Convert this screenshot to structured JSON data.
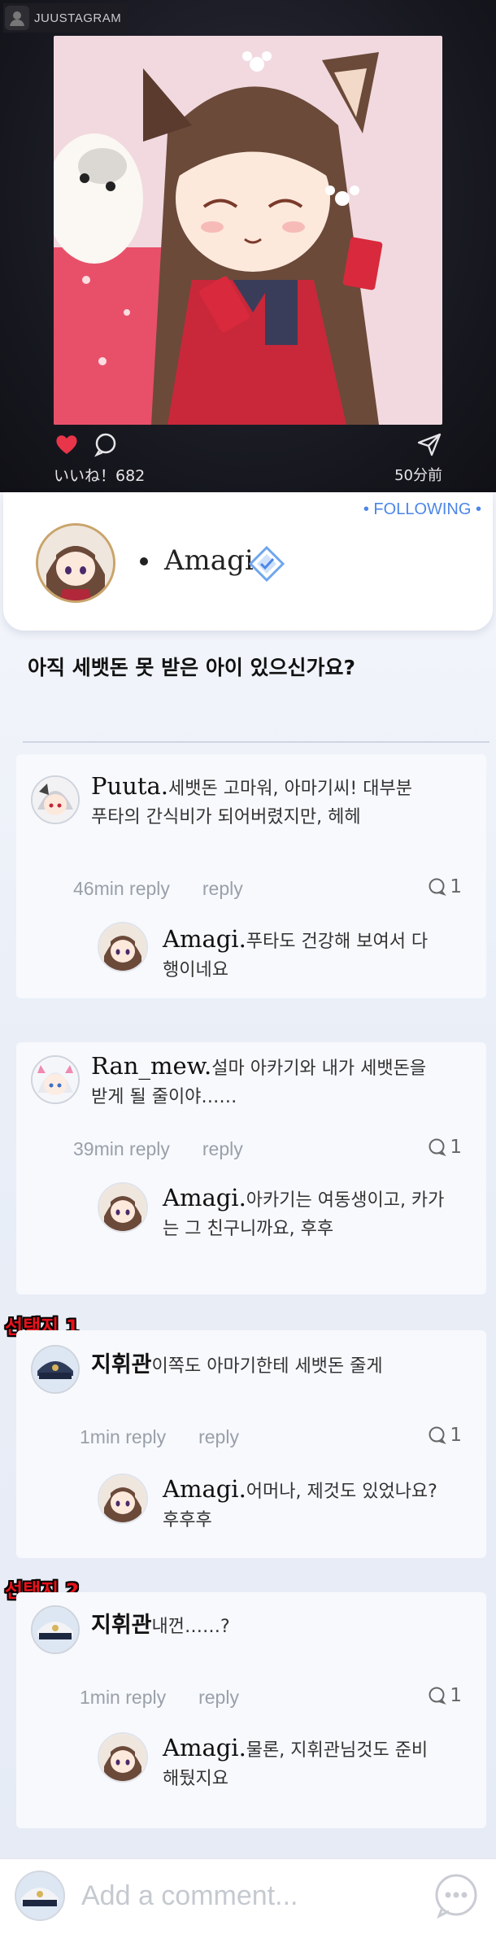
{
  "app": {
    "brand": "JUUSTAGRAM"
  },
  "post": {
    "likes": "いいね！682",
    "time": "50分前"
  },
  "profile": {
    "name": "Amagi",
    "following": "• FOLLOWING •"
  },
  "question": "아직 세뱃돈 못 받은 아이 있으신가요?",
  "comments": [
    {
      "user": "Puuta.",
      "text_line1": "세뱃돈 고마워, 아마기씨! 대부분",
      "text_line2": "푸타의 간식비가 되어버렸지만, 헤헤",
      "time": "46min reply",
      "reply_label": "reply",
      "reply_count": "1",
      "reply": {
        "user": "Amagi.",
        "text_line1": "푸타도 건강해 보여서 다",
        "text_line2": "행이네요"
      }
    },
    {
      "user": "Ran_mew.",
      "text_line1": "설마 아카기와 내가 세뱃돈을",
      "text_line2": "받게 될 줄이야……",
      "time": "39min reply",
      "reply_label": "reply",
      "reply_count": "1",
      "reply": {
        "user": "Amagi.",
        "text_line1": "아카기는 여동생이고, 카가",
        "text_line2": "는 그 친구니까요, 후후"
      }
    },
    {
      "choice": "선택지 1",
      "user": "지휘관",
      "text_line1": "이쪽도 아마기한테 세뱃돈 줄게",
      "text_line2": "",
      "time": "1min reply",
      "reply_label": "reply",
      "reply_count": "1",
      "reply": {
        "user": "Amagi.",
        "text_line1": "어머나, 제것도 있었나요?",
        "text_line2": "후후후"
      }
    },
    {
      "choice": "선택지 2",
      "user": "지휘관",
      "text_line1": "내껀……?",
      "text_line2": "",
      "time": "1min reply",
      "reply_label": "reply",
      "reply_count": "1",
      "reply": {
        "user": "Amagi.",
        "text_line1": "물론, 지휘관님것도 준비",
        "text_line2": "해뒀지요"
      }
    }
  ],
  "comment_bar": {
    "placeholder": "Add a comment..."
  },
  "colors": {
    "accent": "#4d86e8",
    "heart": "#e8354a",
    "choice": "#e8121c"
  },
  "icons": [
    "user-silhouette-icon",
    "heart-icon",
    "comment-bubble-icon",
    "send-icon",
    "verified-diamond-icon",
    "reply-bubble-icon",
    "chat-dots-icon"
  ]
}
